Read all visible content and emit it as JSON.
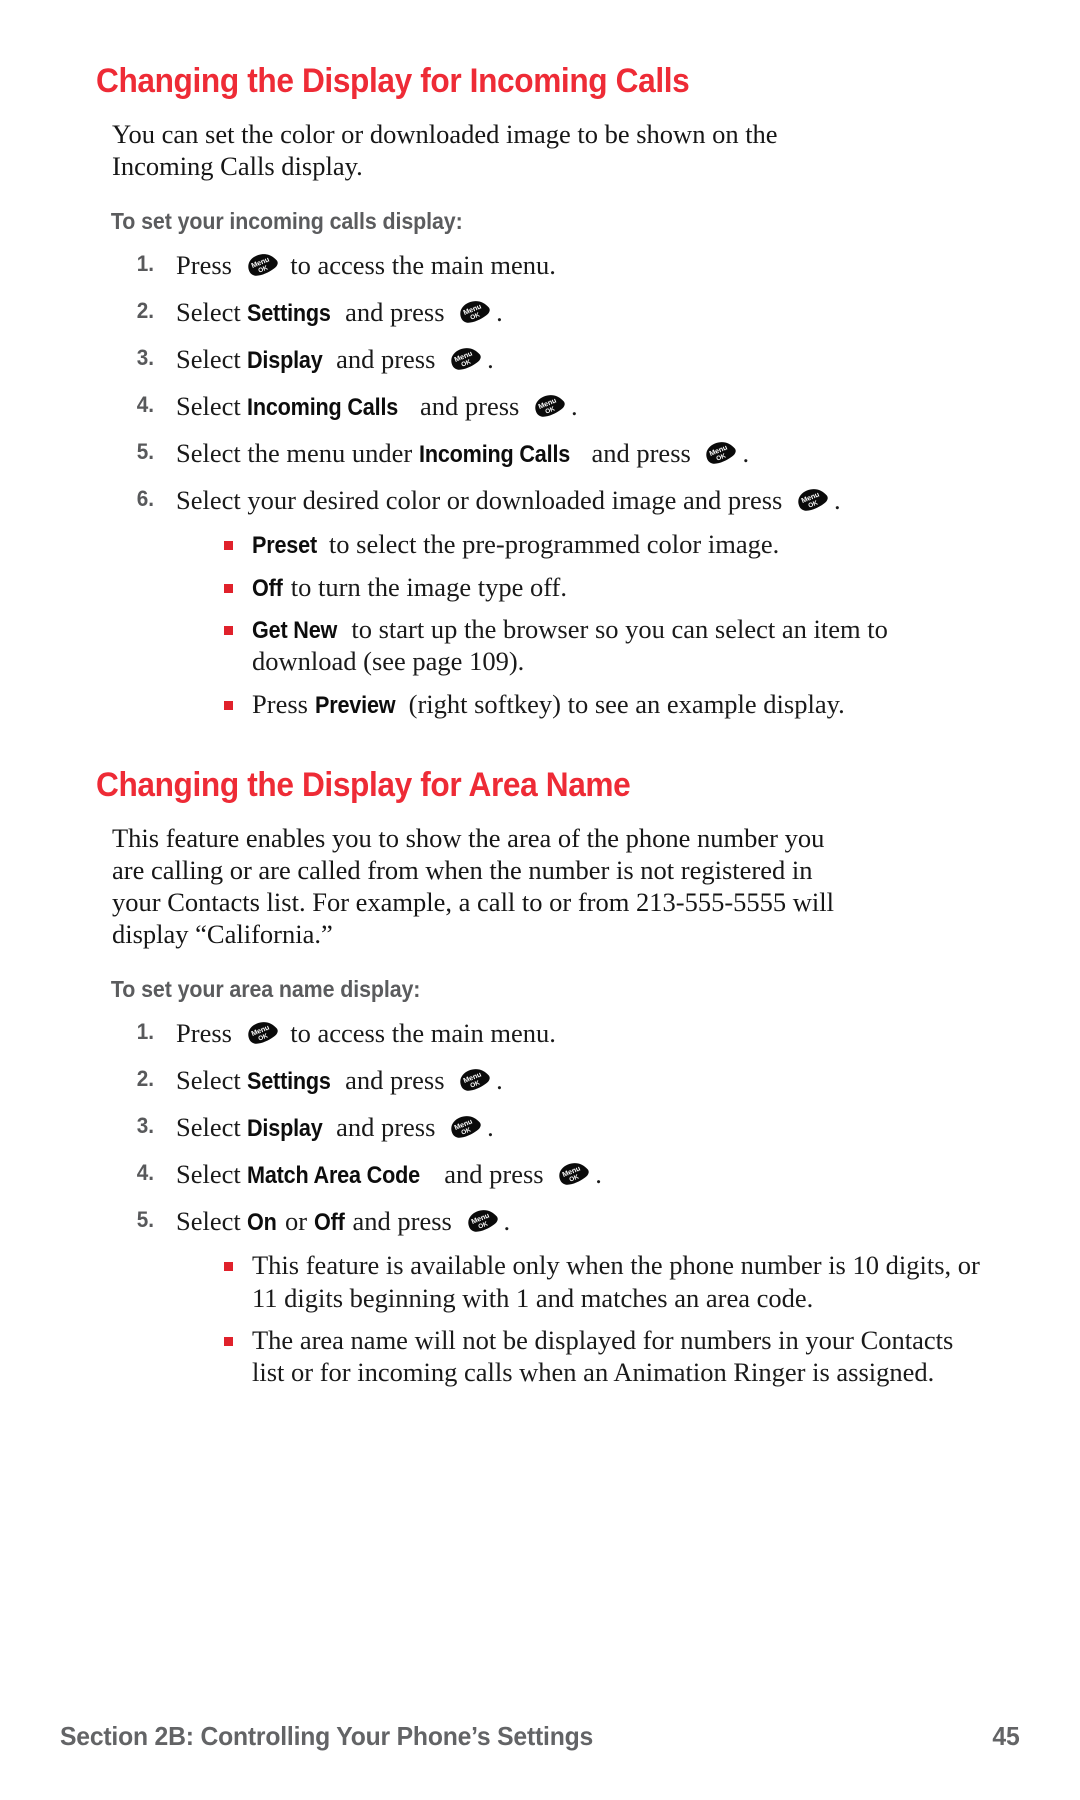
{
  "page": {
    "number": "45",
    "footer_section": "Section 2B: Controlling Your Phone’s Settings",
    "accent_red": "#EE2B36",
    "bullet_red": "#E0212B",
    "subheading_gray": "#5B5C5E",
    "footer_gray": "#636466"
  },
  "icon": {
    "menu_key_label_top": "Menu",
    "menu_key_label_bottom": "OK",
    "name": "menu-ok-key-icon"
  },
  "sections": [
    {
      "heading": "Changing the Display for Incoming Calls",
      "intro": "You can set the color or downloaded image to be shown on the Incoming Calls display.",
      "subheading": "To set your incoming calls display:",
      "steps": [
        {
          "num": "1.",
          "parts": [
            {
              "type": "text",
              "value": "Press "
            },
            {
              "type": "key"
            },
            {
              "type": "text",
              "value": " to access the main menu."
            }
          ]
        },
        {
          "num": "2.",
          "parts": [
            {
              "type": "text",
              "value": "Select "
            },
            {
              "type": "term",
              "value": "Settings"
            },
            {
              "type": "text",
              "value": " and press "
            },
            {
              "type": "key"
            },
            {
              "type": "text",
              "value": "."
            }
          ]
        },
        {
          "num": "3.",
          "parts": [
            {
              "type": "text",
              "value": "Select "
            },
            {
              "type": "term",
              "value": "Display"
            },
            {
              "type": "text",
              "value": " and press "
            },
            {
              "type": "key"
            },
            {
              "type": "text",
              "value": "."
            }
          ]
        },
        {
          "num": "4.",
          "parts": [
            {
              "type": "text",
              "value": "Select "
            },
            {
              "type": "term",
              "value": "Incoming Calls"
            },
            {
              "type": "text",
              "value": " and press "
            },
            {
              "type": "key"
            },
            {
              "type": "text",
              "value": "."
            }
          ]
        },
        {
          "num": "5.",
          "parts": [
            {
              "type": "text",
              "value": "Select the menu under "
            },
            {
              "type": "term",
              "value": "Incoming Calls"
            },
            {
              "type": "text",
              "value": " and press "
            },
            {
              "type": "key"
            },
            {
              "type": "text",
              "value": "."
            }
          ]
        },
        {
          "num": "6.",
          "parts": [
            {
              "type": "text",
              "value": "Select your desired color or downloaded image and press "
            },
            {
              "type": "key"
            },
            {
              "type": "text",
              "value": "."
            }
          ],
          "bullets": [
            [
              {
                "type": "term",
                "value": "Preset"
              },
              {
                "type": "text",
                "value": " to select the pre-programmed color image."
              }
            ],
            [
              {
                "type": "term",
                "value": "Off"
              },
              {
                "type": "text",
                "value": " to turn the image type off."
              }
            ],
            [
              {
                "type": "term",
                "value": "Get New"
              },
              {
                "type": "text",
                "value": " to start up the browser so you can select an item to download (see page 109)."
              }
            ],
            [
              {
                "type": "text",
                "value": "Press "
              },
              {
                "type": "term",
                "value": "Preview"
              },
              {
                "type": "text",
                "value": " (right softkey) to see an example display."
              }
            ]
          ]
        }
      ]
    },
    {
      "heading": "Changing the Display for Area Name",
      "intro": "This feature enables you to show the area of the phone number you are calling or are called from when the number is not registered in your Contacts list. For example, a call to or from 213-555-5555 will display “California.”",
      "subheading": "To set your area name display:",
      "steps": [
        {
          "num": "1.",
          "parts": [
            {
              "type": "text",
              "value": "Press "
            },
            {
              "type": "key"
            },
            {
              "type": "text",
              "value": " to access the main menu."
            }
          ]
        },
        {
          "num": "2.",
          "parts": [
            {
              "type": "text",
              "value": "Select "
            },
            {
              "type": "term",
              "value": "Settings"
            },
            {
              "type": "text",
              "value": " and press "
            },
            {
              "type": "key"
            },
            {
              "type": "text",
              "value": "."
            }
          ]
        },
        {
          "num": "3.",
          "parts": [
            {
              "type": "text",
              "value": "Select "
            },
            {
              "type": "term",
              "value": "Display"
            },
            {
              "type": "text",
              "value": " and press "
            },
            {
              "type": "key"
            },
            {
              "type": "text",
              "value": "."
            }
          ]
        },
        {
          "num": "4.",
          "parts": [
            {
              "type": "text",
              "value": "Select "
            },
            {
              "type": "term",
              "value": "Match Area Code"
            },
            {
              "type": "text",
              "value": " and press "
            },
            {
              "type": "key"
            },
            {
              "type": "text",
              "value": "."
            }
          ]
        },
        {
          "num": "5.",
          "parts": [
            {
              "type": "text",
              "value": "Select "
            },
            {
              "type": "term",
              "value": "On"
            },
            {
              "type": "text",
              "value": " or "
            },
            {
              "type": "term",
              "value": "Off"
            },
            {
              "type": "text",
              "value": " and press "
            },
            {
              "type": "key"
            },
            {
              "type": "text",
              "value": "."
            }
          ],
          "bullets": [
            [
              {
                "type": "text",
                "value": "This feature is available only when the phone number is 10 digits, or 11 digits beginning with 1 and matches an area code."
              }
            ],
            [
              {
                "type": "text",
                "value": "The area name will not be displayed for numbers in your Contacts list or for incoming calls when an Animation Ringer is assigned."
              }
            ]
          ]
        }
      ]
    }
  ]
}
